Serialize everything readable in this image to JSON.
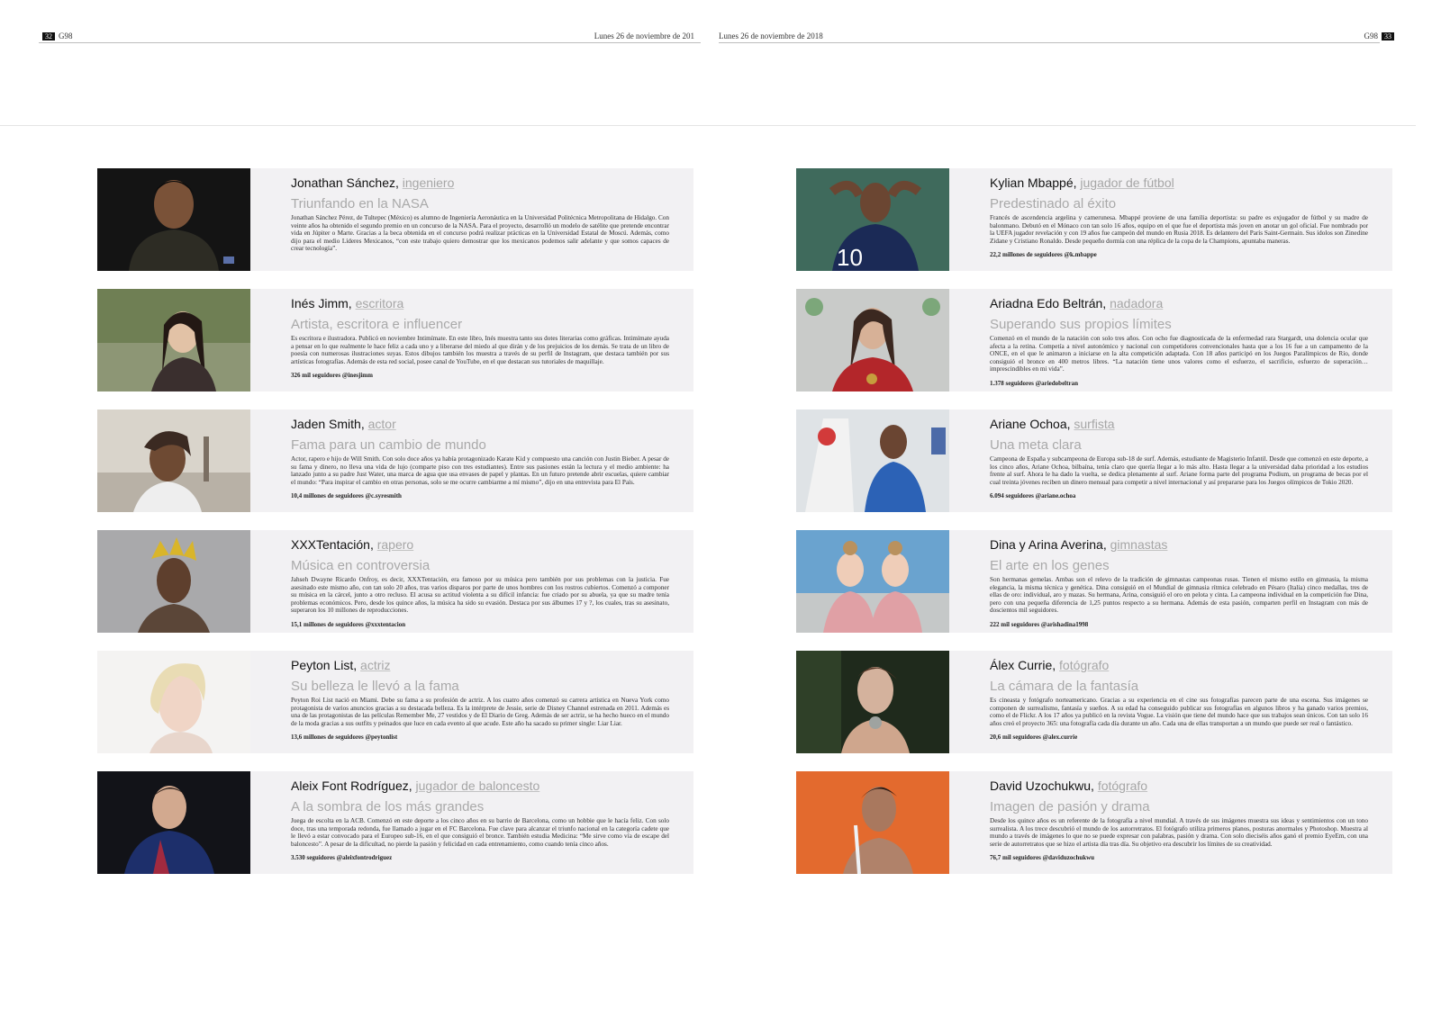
{
  "header": {
    "left_page_number": "32",
    "left_section": "G98",
    "left_date": "Lunes 26 de noviembre de 201",
    "right_date": "Lunes 26 de noviembre de 2018",
    "right_section": "G98",
    "right_page_number": "33"
  },
  "left_profiles": [
    {
      "name": "Jonathan Sánchez,",
      "role": "ingeniero",
      "headline": "Triunfando en la NASA",
      "body": "Jonathan Sánchez Pérez, de Tultepec (México) es alumno de Ingeniería Aeronáutica en la Universidad Politécnica Metropolitana de Hidalgo. Con veinte años ha obtenido el segundo premio en un concurso de la NASA. Para el proyecto, desarrolló un modelo de satélite que pretende encontrar vida en Júpiter o Marte. Gracias a la beca obtenida en el concurso podrá realizar prácticas en la Universidad Estatal de Moscú. Además, como dijo para el medio Líderes Mexicanos, “con este trabajo quiero demostrar que los mexicanos podemos salir adelante y que somos capaces de crear tecnología”.",
      "followers": ""
    },
    {
      "name": "Inés Jimm,",
      "role": "escritora",
      "headline": "Artista, escritora e influencer",
      "body": "Es escritora e ilustradora. Publicó en noviembre Intimímate. En este libro, Inés muestra tanto sus dotes literarias como gráficas. Intimímate ayuda a pensar en lo que realmente le hace feliz a cada uno y a liberarse del miedo al que dirán y de los prejuicios de los demás. Se trata de un libro de poesía con numerosas ilustraciones suyas. Estos dibujos también los muestra a través de su perfil de Instagram, que destaca también por sus artísticas fotografías. Además de esta red social, posee canal de YouTube, en el que destacan sus tutoriales de maquillaje.",
      "followers": "326 mil seguidores @inesjimm"
    },
    {
      "name": "Jaden Smith,",
      "role": "actor",
      "headline": "Fama para un cambio de mundo",
      "body": "Actor, rapero e hijo de Will Smith. Con solo doce años ya había protagonizado Karate Kid y compuesto una canción con Justin Bieber. A pesar de su fama y dinero, no lleva una vida de lujo (comparte piso con tres estudiantes). Entre sus pasiones están la lectura y el medio ambiente: ha lanzado junto a su padre Just Water, una marca de agua que usa envases de papel y plantas. En un futuro pretende abrir escuelas, quiere cambiar el mundo: “Para inspirar el cambio en otras personas, solo se me ocurre cambiarme a mí mismo”, dijo en una entrevista para El País.",
      "followers": "10,4 millones de seguidores @c.syresmith"
    },
    {
      "name": "XXXTentación,",
      "role": "rapero",
      "headline": "Música en controversia",
      "body": "Jahseh Dwayne Ricardo Onfroy, es decir, XXXTentación, era famoso por su música pero también por sus problemas con la justicia. Fue asesinado este mismo año, con tan solo 20 años, tras varios disparos por parte de unos hombres con los rostros cubiertos. Comenzó a componer su música en la cárcel, junto a otro recluso. El acusa su actitud violenta a su difícil infancia: fue criado por su abuela, ya que su madre tenía problemas económicos. Pero, desde los quince años, la música ha sido su evasión. Destaca por sus álbumes 17 y ?, los cuales, tras su asesinato, superaron los 10 millones de reproducciones.",
      "followers": "15,1 millones de seguidores @xxxtentacion"
    },
    {
      "name": "Peyton List,",
      "role": "actriz",
      "headline": "Su belleza le llevó a la fama",
      "body": "Peyton Roi List nació en Miami. Debe su fama a su profesión de actriz. A los cuatro años comenzó su carrera artística en Nueva York como protagonista de varios anuncios gracias a su destacada belleza. Es la intérprete de Jessie, serie de Disney Channel estrenada en 2011. Además es una de las protagonistas de las películas Remember Me, 27 vestidos y de El Diario de Greg. Además de ser actriz, se ha hecho hueco en el mundo de la moda gracias a sus outfits y peinados que luce en cada evento al que acude. Este año ha sacado su primer single: Liar Liar.",
      "followers": "13,6 millones de seguidores @peytonlist"
    },
    {
      "name": "Aleix Font Rodríguez,",
      "role": "jugador de baloncesto",
      "headline": "A la sombra de los más grandes",
      "body": "Juega de escolta en la ACB. Comenzó en este deporte a los cinco años en su barrio de Barcelona, como un hobbie que le hacía feliz. Con solo doce, tras una temporada redonda, fue llamado a jugar en el FC Barcelona. Fue clave para alcanzar el triunfo nacional en la categoría cadete que le llevó a estar convocado para el Europeo sub-16, en el que consiguió el bronce. También estudia Medicina: “Me sirve como vía de escape del baloncesto”. A pesar de la dificultad, no pierde la pasión y felicidad en cada entrenamiento, como cuando tenía cinco años.",
      "followers": "3.530 seguidores @aleixfontrodriguez"
    }
  ],
  "right_profiles": [
    {
      "name": "Kylian Mbappé,",
      "role": "jugador de fútbol",
      "headline": "Predestinado al éxito",
      "body": "Francés de ascendencia argelina y camerunesa. Mbappé proviene de una familia deportista: su padre es exjugador de fútbol y su madre de balonmano. Debutó en el Mónaco con tan solo 16 años, equipo en el que fue el deportista más joven en anotar un gol oficial. Fue nombrado por la UEFA jugador revelación y con 19 años fue campeón del mundo en Rusia 2018. Es delantero del París Saint-Germain. Sus ídolos son Zinedine Zidane y Cristiano Ronaldo. Desde pequeño dormía con una réplica de la copa de la Champions, apuntaba maneras.",
      "followers": "22,2 millones de seguidores @k.mbappe"
    },
    {
      "name": "Ariadna Edo Beltrán,",
      "role": "nadadora",
      "headline": "Superando sus propios límites",
      "body": "Comenzó en el mundo de la natación con solo tres años. Con ocho fue diagnosticada de la enfermedad rara Stargardt, una dolencia ocular que afecta a la retina. Competía a nivel autonómico y nacional con competidores convencionales hasta que a los 16 fue a un campamento de la ONCE, en el que le animaron a iniciarse en la alta competición adaptada. Con 18 años participó en los Juegos Paralímpicos de Río, donde consiguió el bronce en 400 metros libres. “La natación tiene unos valores como el esfuerzo, el sacrificio, esfuerzo de superación…imprescindibles en mi vida”.",
      "followers": "1.378 seguidores @ariedobeltran"
    },
    {
      "name": "Ariane Ochoa,",
      "role": "surfista",
      "headline": "Una meta clara",
      "body": "Campeona de España y subcampeona de Europa sub-18 de surf. Además, estudiante de Magisterio Infantil. Desde que comenzó en este deporte, a los cinco años, Ariane Ochoa, bilbaína, tenía claro que quería llegar a lo más alto. Hasta llegar a la universidad daba prioridad a los estudios frente al surf. Ahora le ha dado la vuelta, se dedica plenamente al surf. Ariane forma parte del programa Podium, un programa de becas por el cual treinta jóvenes reciben un dinero mensual para competir a nivel internacional y así prepararse para los Juegos olímpicos de Tokio 2020.",
      "followers": "6.094 seguidores @ariane.ochoa"
    },
    {
      "name": "Dina y Arina Averina,",
      "role": "gimnastas",
      "headline": "El arte en los genes",
      "body": "Son hermanas gemelas. Ambas son el relevo de la tradición de gimnastas campeonas rusas. Tienen el mismo estilo en gimnasia, la misma elegancia, la misma técnica y genética. Dina consiguió en el Mundial de gimnasia rítmica celebrado en Pésaro (Italia) cinco medallas, tres de ellas de oro: individual, aro y mazas. Su hermana, Arina, consiguió el oro en pelota y cinta. La campeona individual en la competición fue Dina, pero con una pequeña diferencia de 1,25 puntos respecto a su hermana. Además de esta pasión, comparten perfil en Instagram con más de doscientos mil seguidores.",
      "followers": "222 mil seguidores @arishadina1998"
    },
    {
      "name": "Álex Currie,",
      "role": "fotógrafo",
      "headline": "La cámara de la fantasía",
      "body": "Es cineasta y fotógrafo norteamericano. Gracias a su experiencia en el cine sus fotografías parecen parte de una escena. Sus imágenes se componen de surrealismo, fantasía y sueños. A su edad ha conseguido publicar sus fotografías en algunos libros y ha ganado varios premios, como el de Flickr. A los 17 años ya publicó en la revista Vogue. La visión que tiene del mundo hace que sus trabajos sean únicos. Con tan solo 16 años creó el proyecto 365: una fotografía cada día durante un año. Cada una de ellas transportan a un mundo que puede ser real o fantástico.",
      "followers": "20,6 mil seguidores @alex.currie"
    },
    {
      "name": "David Uzochukwu,",
      "role": "fotógrafo",
      "headline": "Imagen de pasión y drama",
      "body": "Desde los quince años es un referente de la fotografía a nivel mundial. A través de sus imágenes muestra sus ideas y sentimientos con un tono surrealista. A los trece descubrió el mundo de los autorretratos. El fotógrafo utiliza primeros planos, posturas anormales y Photoshop. Muestra al mundo a través de imágenes lo que no se puede expresar con palabras, pasión y drama. Con solo dieciséis años ganó el premio EyeEm, con una serie de autorretratos que se hizo el artista día tras día. Su objetivo era descubrir los límites de su creatividad.",
      "followers": "76,7 mil seguidores @daviduzochukwu"
    }
  ]
}
